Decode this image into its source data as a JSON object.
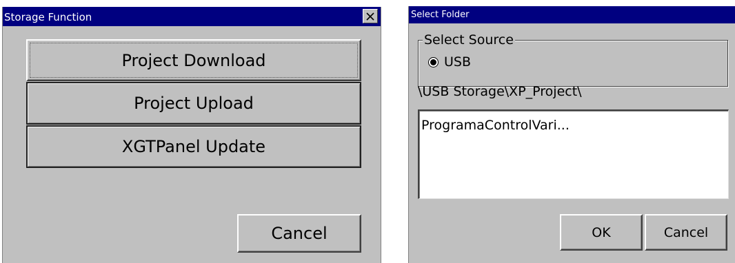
{
  "storage_dialog": {
    "title": "Storage Function",
    "close_glyph": "✕",
    "buttons": {
      "project_download": "Project Download",
      "project_upload": "Project Upload",
      "xgtpanel_update": "XGTPanel Update",
      "cancel": "Cancel"
    }
  },
  "folder_dialog": {
    "title": "Select Folder",
    "group_label": "Select Source",
    "source_option": "USB",
    "current_path": "\\USB Storage\\XP_Project\\",
    "list_items": [
      "ProgramaControlVari..."
    ],
    "buttons": {
      "ok": "OK",
      "cancel": "Cancel"
    }
  },
  "colors": {
    "titlebar": "#000080",
    "window_face": "#c0c0c0"
  }
}
